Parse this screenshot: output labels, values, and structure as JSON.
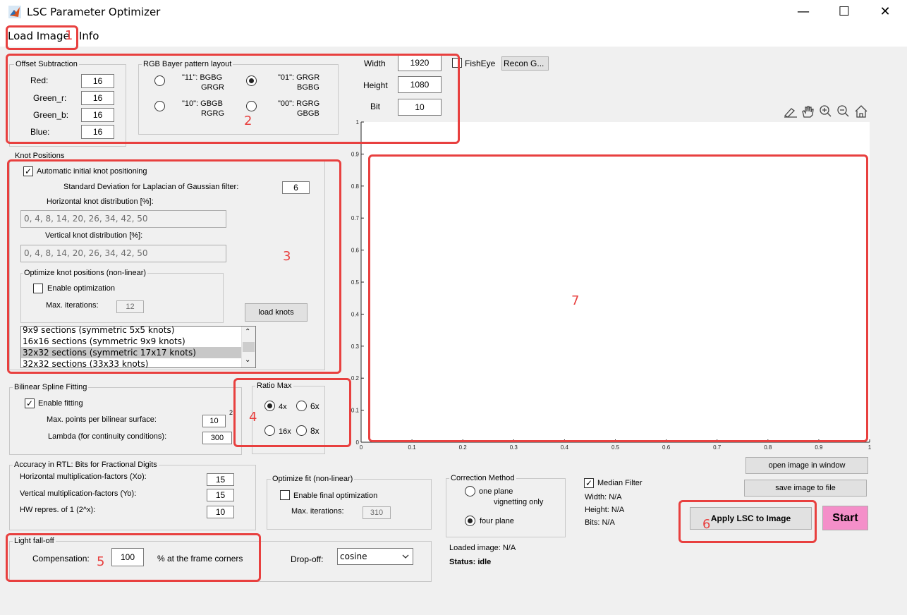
{
  "window": {
    "title": "LSC Parameter Optimizer",
    "minimize_glyph": "—",
    "maximize_glyph": "☐",
    "close_glyph": "✕"
  },
  "menu": {
    "load_image": "Load Image",
    "info": "Info"
  },
  "offset_subtraction": {
    "title": "Offset Subtraction",
    "red_label": "Red:",
    "red_value": "16",
    "green_r_label": "Green_r:",
    "green_r_value": "16",
    "green_b_label": "Green_b:",
    "green_b_value": "16",
    "blue_label": "Blue:",
    "blue_value": "16"
  },
  "bayer": {
    "title": "RGB Bayer pattern layout",
    "opt11_line1": "\"11\": BGBG",
    "opt11_line2": "GRGR",
    "opt01_line1": "\"01\": GRGR",
    "opt01_line2": "BGBG",
    "opt10_line1": "\"10\": GBGB",
    "opt10_line2": "RGRG",
    "opt00_line1": "\"00\": RGRG",
    "opt00_line2": "GBGB",
    "selected": "01"
  },
  "image_size": {
    "width_label": "Width",
    "width_value": "1920",
    "height_label": "Height",
    "height_value": "1080",
    "bit_label": "Bit",
    "bit_value": "10",
    "fisheye_label": "FishEye",
    "fisheye_checked": false,
    "recon_button": "Recon G..."
  },
  "knots": {
    "title": "Knot Positions",
    "auto_label": "Automatic initial knot positioning",
    "auto_checked": true,
    "std_label": "Standard Deviation for Laplacian of Gaussian filter:",
    "std_value": "6",
    "horiz_label": "Horizontal knot distribution [%]:",
    "horiz_value": "0, 4, 8, 14, 20, 26, 34, 42, 50",
    "vert_label": "Vertical knot distribution [%]:",
    "vert_value": "0, 4, 8, 14, 20, 26, 34, 42, 50",
    "opt_title": "Optimize knot positions (non-linear)",
    "enable_opt_label": "Enable optimization",
    "enable_opt_checked": false,
    "max_iter_label": "Max. iterations:",
    "max_iter_value": "12",
    "load_knots_button": "load knots",
    "list_items": [
      "9x9 sections (symmetric 5x5 knots)",
      "16x16 sections (symmetric 9x9 knots)",
      "32x32 sections (symmetric 17x17 knots)",
      "32x32 sections (33x33 knots)"
    ],
    "selected_index": 2
  },
  "bilinear": {
    "title": "Bilinear Spline Fitting",
    "enable_label": "Enable fitting",
    "enable_checked": true,
    "maxpts_label": "Max. points per bilinear surface:",
    "maxpts_value": "10",
    "superscript": "2",
    "lambda_label": "Lambda (for continuity conditions):",
    "lambda_value": "300"
  },
  "ratio_max": {
    "title": "Ratio Max",
    "opt_4x": "4x",
    "opt_6x": "6x",
    "opt_16x": "16x",
    "opt_8x": "8x",
    "selected": "4x"
  },
  "accuracy": {
    "title": "Accuracy in RTL: Bits for Fractional Digits",
    "xo_label": "Horizontal multiplication-factors (Xo):",
    "xo_value": "15",
    "yo_label": "Vertical multiplication-factors (Yo):",
    "yo_value": "15",
    "hw_label": "HW repres. of 1 (2^x):",
    "hw_value": "10"
  },
  "optimize_fit": {
    "title": "Optimize fit (non-linear)",
    "enable_label": "Enable final optimization",
    "enable_checked": false,
    "max_iter_label": "Max. iterations:",
    "max_iter_value": "310"
  },
  "correction": {
    "title": "Correction Method",
    "one_plane_line1": "one plane",
    "one_plane_line2": "vignetting only",
    "four_plane": "four plane",
    "selected": "four plane"
  },
  "median": {
    "label": "Median Filter",
    "checked": true,
    "width_text": "Width: N/A",
    "height_text": "Height: N/A",
    "bits_text": "Bits: N/A"
  },
  "status": {
    "loaded_image": "Loaded image: N/A",
    "status_text": "Status: idle"
  },
  "falloff": {
    "title": "Light fall-off",
    "compensation_label": "Compensation:",
    "compensation_value": "100",
    "corners_label": "% at the frame corners",
    "dropoff_label": "Drop-off:",
    "dropoff_value": "cosine"
  },
  "buttons": {
    "open_image": "open image in window",
    "save_image": "save image to file",
    "apply_lsc": "Apply LSC to Image",
    "start": "Start"
  },
  "axes": {
    "x_ticks": [
      "0",
      "0.1",
      "0.2",
      "0.3",
      "0.4",
      "0.5",
      "0.6",
      "0.7",
      "0.8",
      "0.9",
      "1"
    ],
    "y_ticks": [
      "0",
      "0.1",
      "0.2",
      "0.3",
      "0.4",
      "0.5",
      "0.6",
      "0.7",
      "0.8",
      "0.9",
      "1"
    ]
  },
  "annotations": [
    "1",
    "2",
    "3",
    "4",
    "5",
    "6",
    "7"
  ],
  "colors": {
    "annotation_red": "#e8403f",
    "start_pink": "#f48fc9",
    "list_selected": "#c8c8c8"
  },
  "toolbar_icons": [
    "brush-icon",
    "pan-hand-icon",
    "zoom-in-icon",
    "zoom-out-icon",
    "home-icon"
  ]
}
